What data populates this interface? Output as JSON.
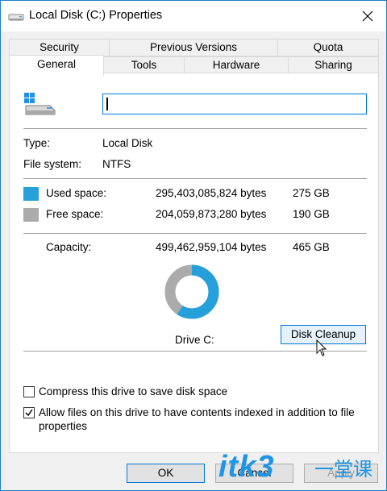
{
  "window": {
    "title": "Local Disk (C:) Properties"
  },
  "tabs": {
    "row1": [
      {
        "label": "Security"
      },
      {
        "label": "Previous Versions"
      },
      {
        "label": "Quota"
      }
    ],
    "row2": [
      {
        "label": "General",
        "active": true
      },
      {
        "label": "Tools"
      },
      {
        "label": "Hardware"
      },
      {
        "label": "Sharing"
      }
    ]
  },
  "general": {
    "name_value": "",
    "type_label": "Type:",
    "type_value": "Local Disk",
    "fs_label": "File system:",
    "fs_value": "NTFS",
    "used": {
      "label": "Used space:",
      "bytes": "295,403,085,824 bytes",
      "size": "275 GB",
      "color": "#26a0da"
    },
    "free": {
      "label": "Free space:",
      "bytes": "204,059,873,280 bytes",
      "size": "190 GB",
      "color": "#ababab"
    },
    "capacity": {
      "label": "Capacity:",
      "bytes": "499,462,959,104 bytes",
      "size": "465 GB"
    },
    "used_fraction": 0.5914,
    "drive_label": "Drive C:",
    "disk_cleanup_label": "Disk Cleanup",
    "compress_label": "Compress this drive to save disk space",
    "compress_checked": false,
    "index_label_line1": "Allow files on this drive to have contents indexed in addition to file",
    "index_label_line2": "properties",
    "index_checked": true
  },
  "buttons": {
    "ok": "OK",
    "cancel": "Cancel",
    "apply": "Apply"
  },
  "watermark": {
    "text": "itk3",
    "suffix": "一堂课"
  }
}
